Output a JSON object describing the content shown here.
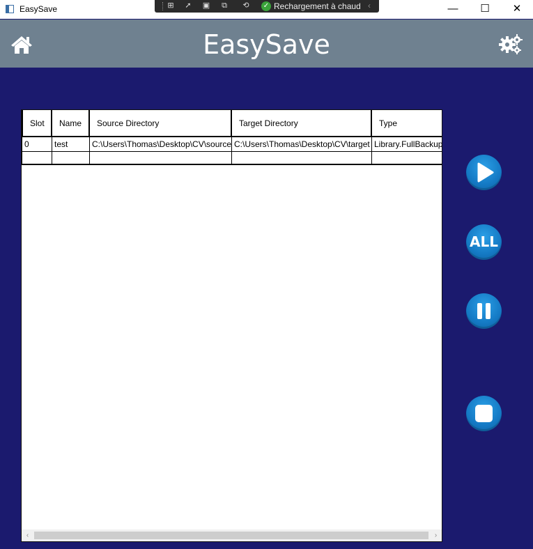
{
  "window": {
    "title": "EasySave",
    "minimize": "—",
    "maximize": "☐",
    "close": "✕"
  },
  "debug_toolbar": {
    "hot_reload_label": "Rechargement à chaud",
    "icons": [
      "select-element-icon",
      "pointer-icon",
      "layout-adorner-icon",
      "track-focus-icon",
      "binding-failures-icon"
    ]
  },
  "header": {
    "title": "EasySave",
    "background": "#6f8190"
  },
  "grid": {
    "columns": [
      "Slot",
      "Name",
      "Source Directory",
      "Target Directory",
      "Type"
    ],
    "rows": [
      {
        "slot": "0",
        "name": "test",
        "source": "C:\\Users\\Thomas\\Desktop\\CV\\source",
        "target": "C:\\Users\\Thomas\\Desktop\\CV\\target",
        "type": "Library.FullBackup"
      },
      {
        "slot": "",
        "name": "",
        "source": "",
        "target": "",
        "type": ""
      }
    ],
    "scroll_left": "‹",
    "scroll_right": "›"
  },
  "actions": {
    "all_label": "ALL",
    "button_color": "#1479c4"
  },
  "colors": {
    "background": "#1b1a6e"
  }
}
